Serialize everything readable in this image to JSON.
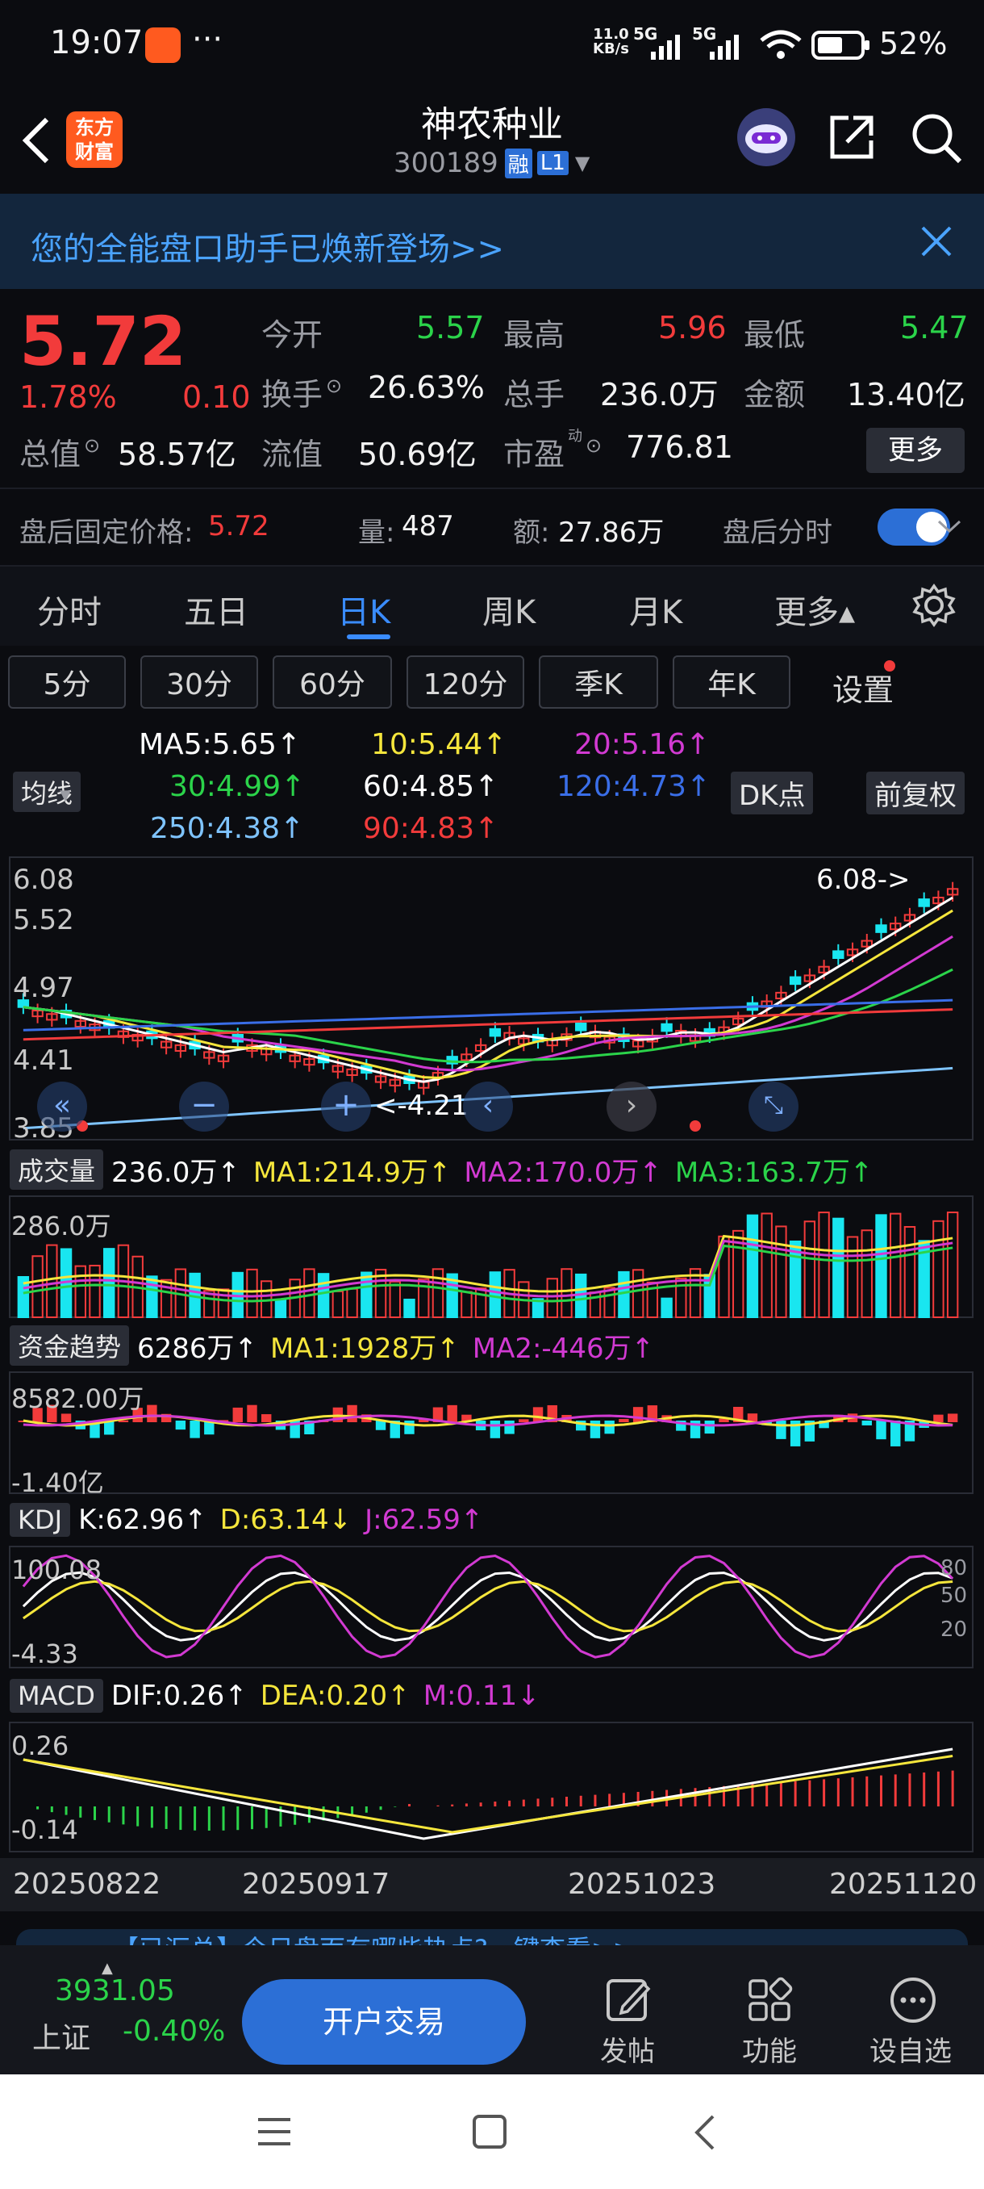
{
  "status": {
    "time": "19:07",
    "dots": "···",
    "net_speed_top": "11.0",
    "net_speed_bottom": "KB/s",
    "sig1": "5G",
    "sig2": "5G",
    "battery": "52%"
  },
  "header": {
    "logo": "东方\n财富",
    "logo_line1": "东方",
    "logo_line2": "财富",
    "title": "神农种业",
    "code": "300189",
    "badge1": "融",
    "badge2": "L1"
  },
  "banner": {
    "text": "您的全能盘口助手已焕新登场>>"
  },
  "quote": {
    "price": "5.72",
    "change_pct": "1.78%",
    "change": "0.10",
    "open_label": "今开",
    "open": "5.57",
    "high_label": "最高",
    "high": "5.96",
    "low_label": "最低",
    "low": "5.47",
    "turnover_label": "换手",
    "turnover": "26.63%",
    "vol_label": "总手",
    "vol": "236.0万",
    "amount_label": "金额",
    "amount": "13.40亿",
    "mktcap_label": "总值",
    "mktcap": "58.57亿",
    "float_label": "流值",
    "float": "50.69亿",
    "pe_label": "市盈",
    "pe_sup": "动",
    "pe": "776.81",
    "more": "更多",
    "after_label": "盘后固定价格:",
    "after_price": "5.72",
    "after_vol_label": "量:",
    "after_vol": "487",
    "after_amt_label": "额:",
    "after_amt": "27.86万",
    "after_ts_label": "盘后分时"
  },
  "tabs": [
    {
      "label": "分时"
    },
    {
      "label": "五日"
    },
    {
      "label": "日K"
    },
    {
      "label": "周K"
    },
    {
      "label": "月K"
    },
    {
      "label": "更多▴"
    }
  ],
  "subtabs": [
    {
      "label": "5分"
    },
    {
      "label": "30分"
    },
    {
      "label": "60分"
    },
    {
      "label": "120分"
    },
    {
      "label": "季K"
    },
    {
      "label": "年K"
    },
    {
      "label": "设置"
    }
  ],
  "ma": {
    "selector": "均线",
    "dk": "DK点",
    "adjust": "前复权",
    "ma5": "MA5:5.65↑",
    "ma10": "10:5.44↑",
    "ma20": "20:5.16↑",
    "ma30": "30:4.99↑",
    "ma60": "60:4.85↑",
    "ma120": "120:4.73↑",
    "ma250": "250:4.38↑",
    "ma90": "90:4.83↑",
    "colors": {
      "ma5": "#ffffff",
      "ma10": "#f5e63c",
      "ma20": "#d23ad2",
      "ma30": "#2bd44a",
      "ma60": "#ffffff",
      "ma120": "#3a6ee8",
      "ma250": "#7fc4ff",
      "ma90": "#f23b3b"
    }
  },
  "kchart": {
    "y_labels": [
      "6.08",
      "5.52",
      "4.97",
      "4.41",
      "3.85"
    ],
    "high_marker": "6.08->",
    "low_marker": "<-4.21"
  },
  "volume": {
    "label": "成交量",
    "value": "236.0万↑",
    "ma1": "MA1:214.9万↑",
    "ma2": "MA2:170.0万↑",
    "ma3": "MA3:163.7万↑",
    "top": "286.0万"
  },
  "fund": {
    "label": "资金趋势",
    "value": "6286万↑",
    "ma1": "MA1:1928万↑",
    "ma2": "MA2:-446万↑",
    "top": "8582.00万",
    "bottom": "-1.40亿"
  },
  "kdj": {
    "label": "KDJ",
    "k": "K:62.96↑",
    "d": "D:63.14↓",
    "j": "J:62.59↑",
    "top": "100.08",
    "bottom": "-4.33",
    "r80": "80",
    "r50": "50",
    "r20": "20"
  },
  "macd": {
    "label": "MACD",
    "dif": "DIF:0.26↑",
    "dea": "DEA:0.20↑",
    "m": "M:0.11↓",
    "top": "0.26",
    "bottom": "-0.14"
  },
  "dates": [
    "20250822",
    "20250917",
    "20251023",
    "20251120"
  ],
  "ticker": {
    "text": "【已汇总】今日盘面有哪些热点?一键查看>>"
  },
  "bottom": {
    "index_value": "3931.05",
    "index_name": "上证",
    "index_change": "-0.40%",
    "trade_button": "开户交易",
    "post": "发帖",
    "func": "功能",
    "watch": "设自选"
  }
}
